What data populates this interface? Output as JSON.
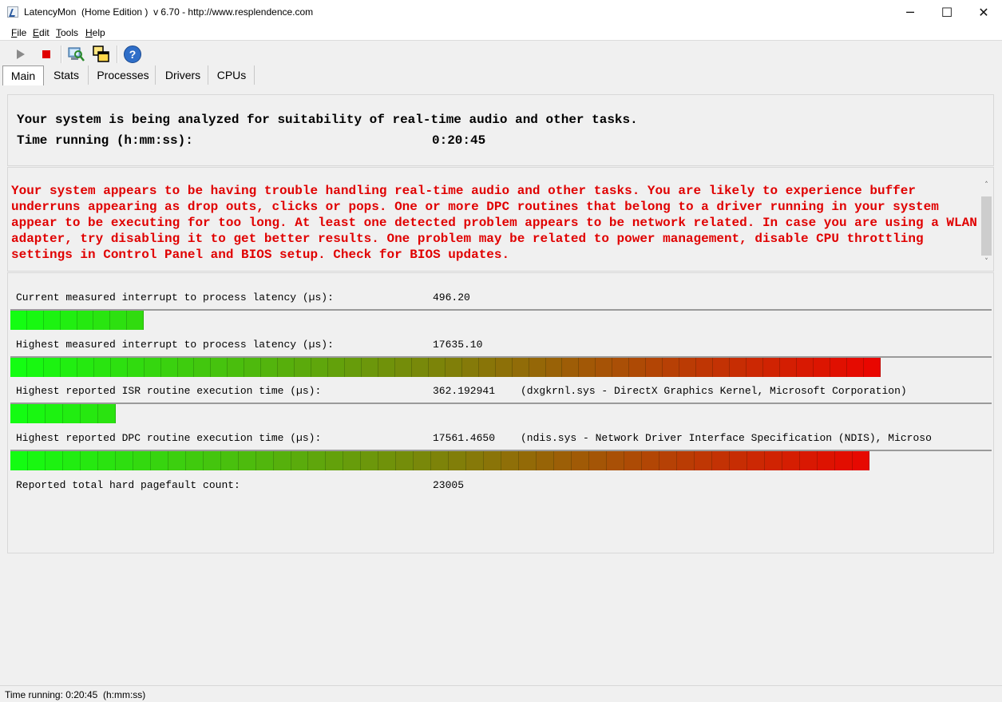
{
  "window": {
    "title": "LatencyMon  (Home Edition )  v 6.70 - http://www.resplendence.com",
    "minimize_glyph": "─",
    "maximize_glyph": "☐",
    "close_glyph": "✕"
  },
  "menu": [
    {
      "acc": "F",
      "rest": "ile"
    },
    {
      "acc": "E",
      "rest": "dit"
    },
    {
      "acc": "T",
      "rest": "ools"
    },
    {
      "acc": "H",
      "rest": "elp"
    }
  ],
  "toolbar": {
    "icons": [
      "play-icon",
      "stop-icon",
      "search-computer-icon",
      "windows-icon",
      "help-icon"
    ],
    "help_glyph": "?"
  },
  "tabs": [
    {
      "label": "Main",
      "active": true
    },
    {
      "label": "Stats",
      "active": false
    },
    {
      "label": "Processes",
      "active": false
    },
    {
      "label": "Drivers",
      "active": false
    },
    {
      "label": "CPUs",
      "active": false
    }
  ],
  "summary": {
    "status_line": "Your system is being analyzed for suitability of real-time audio and other tasks.",
    "time_label": "Time running (h:mm:ss):",
    "time_value": "0:20:45"
  },
  "warning": {
    "text": "Your system appears to be having trouble handling real-time audio and other tasks. You are likely to experience buffer underruns appearing as drop outs, clicks or pops. One or more DPC routines that belong to a driver running in your system appear to be executing for too long. At least one detected problem appears to be network related. In case you are using a WLAN adapter, try disabling it to get better results. One problem may be related to power management, disable CPU throttling settings in Control Panel and BIOS setup. Check for BIOS updates.",
    "color": "#e00000",
    "scroll_up": "˄",
    "scroll_down": "˅"
  },
  "metrics": [
    {
      "label": "Current measured interrupt to process latency (µs):",
      "value": "496.20",
      "detail": "",
      "segments": 8,
      "level": 0.136
    },
    {
      "label": "Highest measured interrupt to process latency (µs):",
      "value": "17635.10",
      "detail": "",
      "segments": 52,
      "level": 0.887
    },
    {
      "label": "Highest reported ISR routine execution time (µs):",
      "value": "362.192941",
      "detail": "(dxgkrnl.sys - DirectX Graphics Kernel, Microsoft Corporation)",
      "segments": 6,
      "level": 0.107
    },
    {
      "label": "Highest reported DPC routine execution time (µs):",
      "value": "17561.4650",
      "detail": "(ndis.sys - Network Driver Interface Specification (NDIS), Microso",
      "segments": 49,
      "level": 0.876
    }
  ],
  "pagefault": {
    "label": "Reported total hard pagefault count:",
    "value": "23005"
  },
  "status_bar": {
    "text": "Time running: 0:20:45  (h:mm:ss)"
  },
  "colors": {
    "bar_start": "#12ff12",
    "bar_end": "#ee0000",
    "panel_bg": "#f0f0f0"
  }
}
